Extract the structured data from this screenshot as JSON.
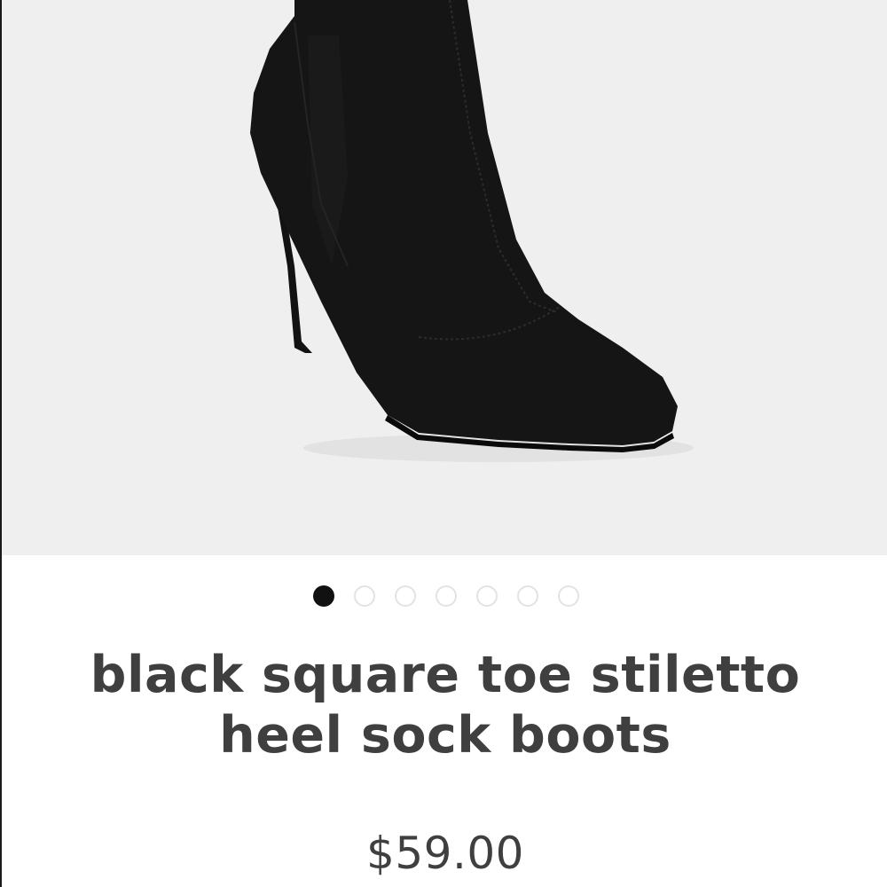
{
  "product": {
    "image_description_icon": "boot-photo",
    "title": "black square toe stiletto heel sock boots",
    "price": "$59.00"
  },
  "carousel": {
    "total_slides": 7,
    "active_index": 0,
    "dot_icon": "dot-indicator"
  },
  "colors": {
    "image_background": "#efefef",
    "text": "#3f3f3f",
    "dot_active": "#111111",
    "dot_inactive_border": "#e3e3e3"
  }
}
